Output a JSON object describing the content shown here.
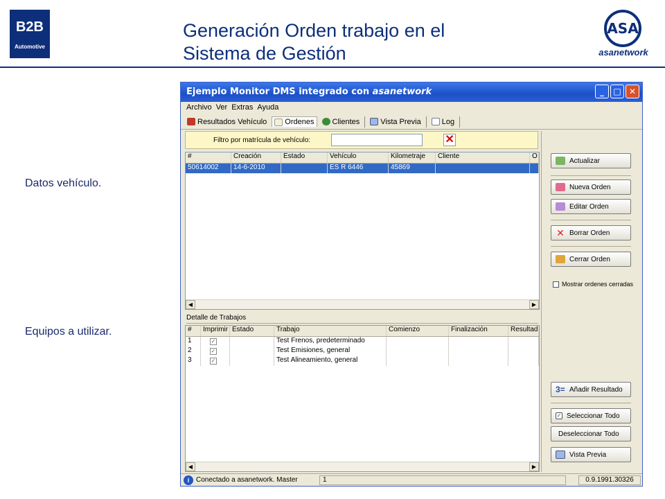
{
  "slide": {
    "logo_main": "B2B",
    "logo_sub": "Automotive",
    "title_line1": "Generación Orden trabajo en el",
    "title_line2": "Sistema de Gestión",
    "asa_mark": "ASA",
    "asa_text": "asanetwork",
    "label_vehicle": "Datos vehículo.",
    "label_equipment": "Equipos a utilizar."
  },
  "window": {
    "title_prefix": "Ejemplo Monitor DMS integrado con",
    "title_brand": "asanetwork",
    "menu": [
      "Archivo",
      "Ver",
      "Extras",
      "Ayuda"
    ],
    "tabs": [
      "Resultados Vehículo",
      "Ordenes",
      "Clientes",
      "Vista Previa",
      "Log"
    ],
    "filter_label": "Filtro por matrícula de vehículo:",
    "filter_value": "",
    "grid1": {
      "headers": [
        "#",
        "Creación",
        "Estado",
        "Vehículo",
        "Kilometraje",
        "Cliente",
        "O"
      ],
      "row": [
        "50614002",
        "14-6-2010",
        "",
        "ES R 6446",
        "45869",
        "",
        ""
      ]
    },
    "detail_label": "Detalle de Trabajos",
    "grid2": {
      "headers": [
        "#",
        "Imprimir",
        "Estado",
        "Trabajo",
        "Comienzo",
        "Finalización",
        "Resultado"
      ],
      "rows": [
        {
          "n": "1",
          "job": "Test Frenos, predeterminado"
        },
        {
          "n": "2",
          "job": "Test Emisiones, general"
        },
        {
          "n": "3",
          "job": "Test Alineamiento, general"
        }
      ]
    },
    "buttons": {
      "actualizar": "Actualizar",
      "nueva": "Nueva Orden",
      "editar": "Editar Orden",
      "borrar": "Borrar Orden",
      "cerrar": "Cerrar Orden",
      "mostrar": "Mostrar ordenes cerradas",
      "anadir": "Añadir Resultado",
      "seleccionar": "Seleccionar Todo",
      "deseleccionar": "Deseleccionar Todo",
      "vista": "Vista Previa"
    },
    "status": {
      "info_glyph": "i",
      "text": "Conectado a asanetwork. Master",
      "field": "1",
      "version": "0.9.1991.30326"
    }
  }
}
